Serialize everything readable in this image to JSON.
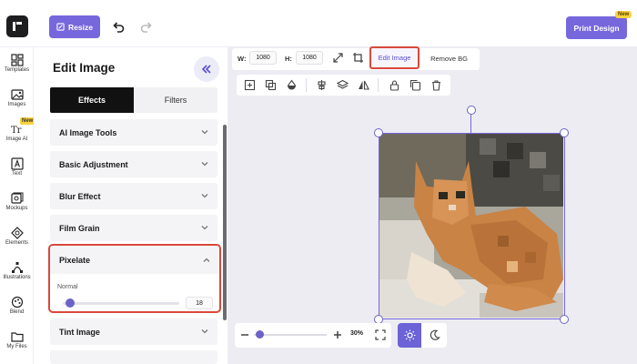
{
  "colors": {
    "accent": "#7667dc",
    "highlight": "#d9483b",
    "badge": "#f9d23f",
    "canvas_bg": "#ececf2"
  },
  "topbar": {
    "resize_label": "Resize",
    "print_label": "Print Design",
    "print_badge": "New",
    "icons": [
      "logo-icon",
      "resize-icon",
      "undo-icon",
      "redo-icon"
    ]
  },
  "rail": {
    "items": [
      {
        "label": "Templates",
        "icon": "templates-icon"
      },
      {
        "label": "Images",
        "icon": "images-icon"
      },
      {
        "label": "Image AI",
        "icon": "image-ai-icon",
        "badge": "New"
      },
      {
        "label": "Text",
        "icon": "text-icon"
      },
      {
        "label": "Mockups",
        "icon": "mockups-icon"
      },
      {
        "label": "Elements",
        "icon": "elements-icon"
      },
      {
        "label": "Illustrations",
        "icon": "illustrations-icon"
      },
      {
        "label": "Blend",
        "icon": "blend-icon"
      },
      {
        "label": "My Files",
        "icon": "my-files-icon"
      }
    ]
  },
  "panel": {
    "title": "Edit Image",
    "tabs": {
      "effects": "Effects",
      "filters": "Filters"
    },
    "active_tab": "Effects",
    "sections": [
      "AI Image Tools",
      "Basic Adjustment",
      "Blur Effect",
      "Film Grain"
    ],
    "pixelate": {
      "title": "Pixelate",
      "mode": "Normal",
      "value": "18",
      "slider_fraction": 0.05
    },
    "sections_after": [
      "Tint Image"
    ]
  },
  "toolbar": {
    "width_label": "W:",
    "width_value": "1080",
    "height_label": "H:",
    "height_value": "1080",
    "edit_image_label": "Edit Image",
    "remove_bg_label": "Remove BG",
    "row2_icons": [
      "fit-icon",
      "layers-copy-icon",
      "fill-icon",
      "align-center-icon",
      "layers-icon",
      "flip-icon",
      "lock-icon",
      "duplicate-icon",
      "trash-icon"
    ]
  },
  "zoom": {
    "value": "30%",
    "slider_fraction": 0.03
  },
  "theme": {
    "active": "light"
  }
}
